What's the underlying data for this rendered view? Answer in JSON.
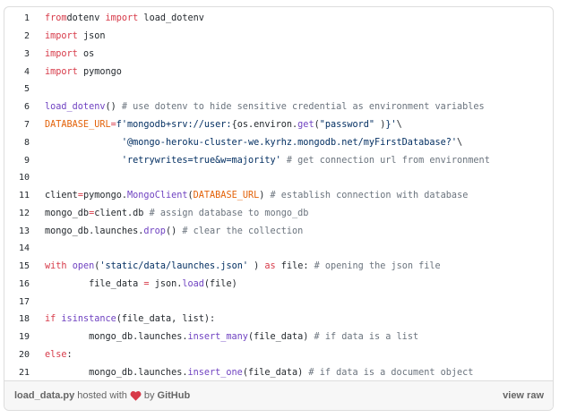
{
  "file": {
    "lines": [
      {
        "num": "1",
        "tokens": [
          [
            "k",
            "from"
          ],
          [
            "",
            "dotenv "
          ],
          [
            "k",
            "import"
          ],
          [
            "",
            " load_dotenv"
          ]
        ]
      },
      {
        "num": "2",
        "tokens": [
          [
            "k",
            "import"
          ],
          [
            "",
            " json"
          ]
        ]
      },
      {
        "num": "3",
        "tokens": [
          [
            "k",
            "import"
          ],
          [
            "",
            " os"
          ]
        ]
      },
      {
        "num": "4",
        "tokens": [
          [
            "k",
            "import"
          ],
          [
            "",
            " pymongo"
          ]
        ]
      },
      {
        "num": "5",
        "tokens": []
      },
      {
        "num": "6",
        "tokens": [
          [
            "f",
            "load_dotenv"
          ],
          [
            "",
            "() "
          ],
          [
            "c",
            "# use dotenv to hide sensitive credential as environment variables"
          ]
        ]
      },
      {
        "num": "7",
        "tokens": [
          [
            "v",
            "DATABASE_URL"
          ],
          [
            "k",
            "="
          ],
          [
            "s",
            "f'mongodb+srv://user:"
          ],
          [
            "",
            "{os.environ."
          ],
          [
            "f",
            "get"
          ],
          [
            "",
            "("
          ],
          [
            "s",
            "\"password\""
          ],
          [
            "",
            " )"
          ],
          [
            "s",
            "}'"
          ],
          [
            "",
            "\\"
          ]
        ]
      },
      {
        "num": "8",
        "tokens": [
          [
            "",
            "              "
          ],
          [
            "s",
            "'@mongo-heroku-cluster-we.kyrhz.mongodb.net/myFirstDatabase?'"
          ],
          [
            "",
            "\\"
          ]
        ]
      },
      {
        "num": "9",
        "tokens": [
          [
            "",
            "              "
          ],
          [
            "s",
            "'retrywrites=true&w=majority'"
          ],
          [
            "",
            " "
          ],
          [
            "c",
            "# get connection url from environment"
          ]
        ]
      },
      {
        "num": "10",
        "tokens": []
      },
      {
        "num": "11",
        "tokens": [
          [
            "",
            "client"
          ],
          [
            "k",
            "="
          ],
          [
            "",
            "pymongo."
          ],
          [
            "f",
            "MongoClient"
          ],
          [
            "",
            "("
          ],
          [
            "v",
            "DATABASE_URL"
          ],
          [
            "",
            ") "
          ],
          [
            "c",
            "# establish connection with database"
          ]
        ]
      },
      {
        "num": "12",
        "tokens": [
          [
            "",
            "mongo_db"
          ],
          [
            "k",
            "="
          ],
          [
            "",
            "client.db "
          ],
          [
            "c",
            "# assign database to mongo_db"
          ]
        ]
      },
      {
        "num": "13",
        "tokens": [
          [
            "",
            "mongo_db.launches."
          ],
          [
            "f",
            "drop"
          ],
          [
            "",
            "() "
          ],
          [
            "c",
            "# clear the collection"
          ]
        ]
      },
      {
        "num": "14",
        "tokens": []
      },
      {
        "num": "15",
        "tokens": [
          [
            "k",
            "with"
          ],
          [
            "",
            " "
          ],
          [
            "f",
            "open"
          ],
          [
            "",
            "("
          ],
          [
            "s",
            "'static/data/launches.json'"
          ],
          [
            "",
            " ) "
          ],
          [
            "k",
            "as"
          ],
          [
            "",
            " file: "
          ],
          [
            "c",
            "# opening the json file"
          ]
        ]
      },
      {
        "num": "16",
        "tokens": [
          [
            "",
            "        file_data "
          ],
          [
            "k",
            "="
          ],
          [
            "",
            " json."
          ],
          [
            "f",
            "load"
          ],
          [
            "",
            "(file)"
          ]
        ]
      },
      {
        "num": "17",
        "tokens": []
      },
      {
        "num": "18",
        "tokens": [
          [
            "k",
            "if"
          ],
          [
            "",
            " "
          ],
          [
            "f",
            "isinstance"
          ],
          [
            "",
            "(file_data, list):"
          ]
        ]
      },
      {
        "num": "19",
        "tokens": [
          [
            "",
            "        mongo_db.launches."
          ],
          [
            "f",
            "insert_many"
          ],
          [
            "",
            "(file_data) "
          ],
          [
            "c",
            "# if data is a list"
          ]
        ]
      },
      {
        "num": "20",
        "tokens": [
          [
            "k",
            "else"
          ],
          [
            "",
            ":"
          ]
        ]
      },
      {
        "num": "21",
        "tokens": [
          [
            "",
            "        mongo_db.launches."
          ],
          [
            "f",
            "insert_one"
          ],
          [
            "",
            "(file_data) "
          ],
          [
            "c",
            "# if data is a document object"
          ]
        ]
      }
    ]
  },
  "footer": {
    "filename": "load_data.py",
    "hosted_with": "hosted with",
    "by": "by",
    "github": "GitHub",
    "view_raw": "view raw",
    "heart_color": "#d73a49"
  }
}
